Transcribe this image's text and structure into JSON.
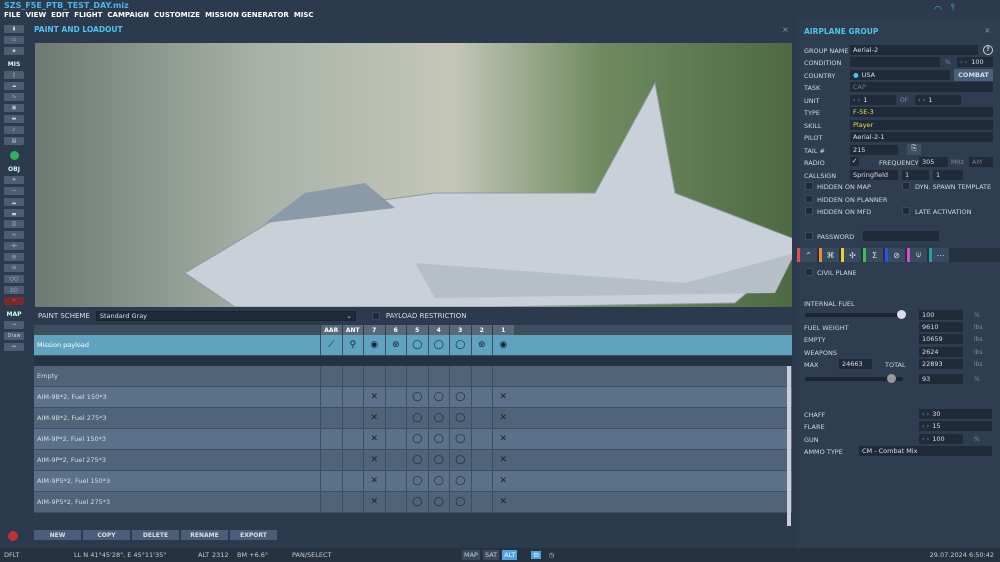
{
  "title": "SZS_F5E_PTB_TEST_DAY.miz",
  "menu": [
    "FILE",
    "VIEW",
    "EDIT",
    "FLIGHT",
    "CAMPAIGN",
    "CUSTOMIZE",
    "MISSION GENERATOR",
    "MISC"
  ],
  "toolbar": {
    "mis": "MIS",
    "obj": "OBJ",
    "map": "MAP",
    "draw": "Draw"
  },
  "panel": {
    "title": "PAINT AND LOADOUT",
    "paint_label": "PAINT SCHEME",
    "paint_value": "Standard Gray",
    "payload_restriction": "PAYLOAD RESTRICTION"
  },
  "table": {
    "columns": [
      "AAR",
      "ANT",
      "7",
      "6",
      "5",
      "4",
      "3",
      "2",
      "1"
    ],
    "selected": {
      "name": "Mission payload",
      "stations": [
        "aar",
        "ant",
        "pod",
        "small",
        "tank",
        "tank",
        "tank",
        "small",
        "pod"
      ]
    },
    "rows": [
      {
        "name": "Empty",
        "stations": [
          "",
          "",
          "",
          "",
          "",
          "",
          "",
          "",
          ""
        ]
      },
      {
        "name": "AIM-9B*2, Fuel 150*3",
        "stations": [
          "",
          "",
          "x",
          "",
          "o",
          "o",
          "o",
          "",
          "x"
        ]
      },
      {
        "name": "AIM-9B*2, Fuel 275*3",
        "stations": [
          "",
          "",
          "x",
          "",
          "o",
          "o",
          "o",
          "",
          "x"
        ]
      },
      {
        "name": "AIM-9P*2, Fuel 150*3",
        "stations": [
          "",
          "",
          "x",
          "",
          "o",
          "o",
          "o",
          "",
          "x"
        ]
      },
      {
        "name": "AIM-9P*2, Fuel 275*3",
        "stations": [
          "",
          "",
          "x",
          "",
          "o",
          "o",
          "o",
          "",
          "x"
        ]
      },
      {
        "name": "AIM-9P5*2, Fuel 150*3",
        "stations": [
          "",
          "",
          "x",
          "",
          "o",
          "o",
          "o",
          "",
          "x"
        ]
      },
      {
        "name": "AIM-9P5*2, Fuel 275*3",
        "stations": [
          "",
          "",
          "x",
          "",
          "o",
          "o",
          "o",
          "",
          "x"
        ]
      }
    ]
  },
  "buttons": [
    "NEW",
    "COPY",
    "DELETE",
    "RENAME",
    "EXPORT"
  ],
  "status": {
    "profile": "DFLT",
    "ll": "LL  N 41°45'28\", E 45°11'35\"",
    "alt_label": "ALT",
    "alt": "2312",
    "bm": "BM  +6.6°",
    "mode": "PAN/SELECT",
    "map": "MAP",
    "sat": "SAT",
    "alt_btn": "ALT",
    "datetime": "29.07.2024 6:50:42"
  },
  "group": {
    "title": "AIRPLANE GROUP",
    "group_name_label": "GROUP NAME",
    "group_name": "Aerial-2",
    "help": "?",
    "condition_label": "CONDITION",
    "condition_pct": "%",
    "condition_value": "100",
    "country_label": "COUNTRY",
    "country": "USA",
    "combat": "COMBAT",
    "task_label": "TASK",
    "task": "CAP",
    "unit_label": "UNIT",
    "unit": "1",
    "of_label": "OF",
    "of": "1",
    "type_label": "TYPE",
    "type": "F-5E-3",
    "skill_label": "SKILL",
    "skill": "Player",
    "pilot_label": "PILOT",
    "pilot": "Aerial-2-1",
    "tail_label": "TAIL #",
    "tail": "215",
    "radio_label": "RADIO",
    "freq_label": "FREQUENCY",
    "freq": "305",
    "mhz": "MHz",
    "am": "AM",
    "callsign_label": "CALLSIGN",
    "callsign": "Springfield",
    "callsign_n1": "1",
    "callsign_n2": "1",
    "hidden_map": "HIDDEN ON MAP",
    "dyn_spawn": "DYN. SPAWN TEMPLATE",
    "hidden_planner": "HIDDEN ON PLANNER",
    "hidden_mfd": "HIDDEN ON MFD",
    "late_activation": "LATE ACTIVATION",
    "password": "PASSWORD",
    "tab_colors": [
      "#e05050",
      "#e89030",
      "#e8d030",
      "#40c050",
      "#3050e0",
      "#d050d0",
      "#20a0a0"
    ],
    "civil_plane": "CIVIL PLANE",
    "internal_fuel_label": "INTERNAL FUEL",
    "internal_fuel": "100",
    "internal_fuel_fraction": 1.0,
    "pct": "%",
    "lbs": "lbs",
    "fuel_weight_label": "FUEL WEIGHT",
    "fuel_weight": "9610",
    "empty_label": "EMPTY",
    "empty": "10659",
    "weapons_label": "WEAPONS",
    "weapons": "2624",
    "max_label": "MAX",
    "max": "24663",
    "total_label": "TOTAL",
    "total": "22893",
    "load_pct": "93",
    "chaff_label": "CHAFF",
    "chaff": "30",
    "flare_label": "FLARE",
    "flare": "15",
    "gun_label": "GUN",
    "gun": "100",
    "ammo_label": "AMMO TYPE",
    "ammo": "CM - Combat Mix"
  }
}
